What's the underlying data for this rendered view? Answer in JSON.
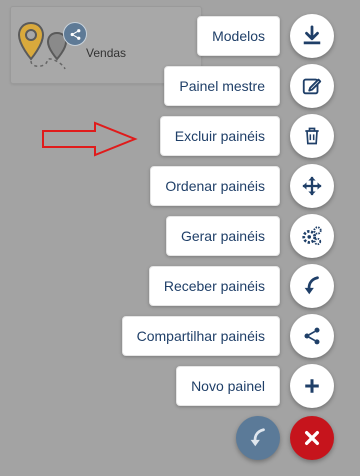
{
  "card": {
    "title": "Vendas"
  },
  "menu": [
    {
      "label": "Modelos",
      "icon": "download-icon"
    },
    {
      "label": "Painel mestre",
      "icon": "edit-icon"
    },
    {
      "label": "Excluir painéis",
      "icon": "trash-icon"
    },
    {
      "label": "Ordenar painéis",
      "icon": "move-icon"
    },
    {
      "label": "Gerar painéis",
      "icon": "cogs-icon"
    },
    {
      "label": "Receber painéis",
      "icon": "receive-arrow-icon"
    },
    {
      "label": "Compartilhar painéis",
      "icon": "share-icon"
    },
    {
      "label": "Novo painel",
      "icon": "plus-icon"
    }
  ],
  "fabs": {
    "receive_icon": "receive-arrow-icon",
    "close_icon": "close-icon"
  },
  "colors": {
    "icon": "#1f3f68",
    "close": "#c6141c",
    "receive": "#5b7a98",
    "arrow": "#e01b1b"
  }
}
